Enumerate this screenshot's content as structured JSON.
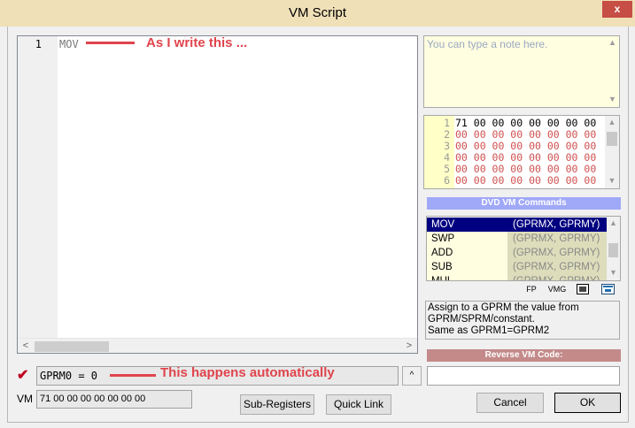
{
  "window": {
    "title": "VM Script",
    "close_glyph": "x"
  },
  "editor": {
    "line_number": "1",
    "code": "MOV",
    "scroll_left": "<",
    "scroll_right": ">"
  },
  "annotations": {
    "editor_note": "As I write this ...",
    "field_note": "This happens automatically",
    "color": "#e0444c"
  },
  "note": {
    "placeholder": "You can type a note here."
  },
  "hex": {
    "lines": [
      {
        "num": "1",
        "bytes": "71 00 00 00 00 00 00 00"
      },
      {
        "num": "2",
        "bytes": "00 00 00 00 00 00 00 00"
      },
      {
        "num": "3",
        "bytes": "00 00 00 00 00 00 00 00"
      },
      {
        "num": "4",
        "bytes": "00 00 00 00 00 00 00 00"
      },
      {
        "num": "5",
        "bytes": "00 00 00 00 00 00 00 00"
      },
      {
        "num": "6",
        "bytes": "00 00 00 00 00 00 00 00"
      }
    ]
  },
  "commands": {
    "header": "DVD VM Commands",
    "items": [
      {
        "name": "MOV",
        "args": "(GPRMX, GPRMY)",
        "selected": true
      },
      {
        "name": "SWP",
        "args": "(GPRMX, GPRMY)",
        "selected": false
      },
      {
        "name": "ADD",
        "args": "(GPRMX, GPRMY)",
        "selected": false
      },
      {
        "name": "SUB",
        "args": "(GPRMX, GPRMY)",
        "selected": false
      },
      {
        "name": "MUL",
        "args": "(GPRMX, GPRMY)",
        "selected": false
      }
    ],
    "toolbar": {
      "fp": "FP",
      "vmg": "VMG"
    },
    "description": "Assign to a GPRM the value from\nGPRM/SPRM/constant.\nSame as GPRM1=GPRM2"
  },
  "reverse": {
    "header": "Reverse VM Code:",
    "value": ""
  },
  "status": {
    "check_glyph": "✔",
    "gprm_text": "GPRM0  =  0",
    "up_glyph": "^",
    "vm_label": "VM",
    "vm_value": "71 00 00 00 00 00 00 00"
  },
  "buttons": {
    "sub_registers": "Sub-Registers",
    "quick_link": "Quick Link",
    "cancel": "Cancel",
    "ok": "OK"
  }
}
